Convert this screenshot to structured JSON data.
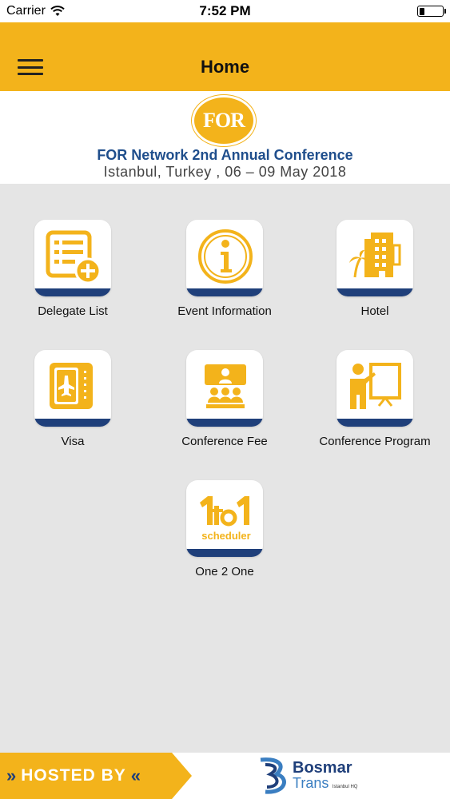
{
  "status_bar": {
    "carrier": "Carrier",
    "time": "7:52 PM"
  },
  "nav": {
    "title": "Home"
  },
  "banner": {
    "logo_text": "FOR",
    "title": "FOR Network 2nd Annual Conference",
    "subtitle": "Istanbul, Turkey , 06 – 09 May  2018"
  },
  "grid": {
    "items": [
      {
        "label": "Delegate List",
        "icon": "delegate-list-icon"
      },
      {
        "label": "Event Information",
        "icon": "info-icon"
      },
      {
        "label": "Hotel",
        "icon": "hotel-icon"
      },
      {
        "label": "Visa",
        "icon": "passport-icon"
      },
      {
        "label": "Conference Fee",
        "icon": "audience-icon"
      },
      {
        "label": "Conference Program",
        "icon": "presenter-icon"
      },
      {
        "label": "One 2 One",
        "icon": "one-to-one-scheduler-icon",
        "icon_text": "scheduler"
      }
    ]
  },
  "footer": {
    "hosted_by": "HOSTED BY",
    "sponsor_name": "Bosmar",
    "sponsor_sub": "Trans",
    "sponsor_tag": "Istanbul HQ"
  },
  "colors": {
    "accent": "#f3b31b",
    "navy": "#1f3f7a",
    "title_blue": "#1f4e8c",
    "background": "#e5e5e5"
  }
}
